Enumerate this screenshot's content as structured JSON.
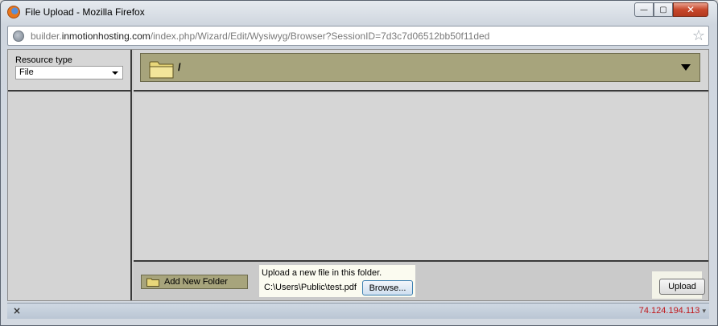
{
  "window": {
    "title": "File Upload - Mozilla Firefox",
    "minimize_glyph": "—",
    "maximize_glyph": "▢",
    "close_glyph": "✕"
  },
  "urlbar": {
    "prefix": "builder.",
    "domain": "inmotionhosting.com",
    "path": "/index.php/Wizard/Edit/Wysiwyg/Browser?SessionID=7d3c7d06512bb50f11ded"
  },
  "sidebar": {
    "resource_type_label": "Resource type",
    "resource_type_value": "File"
  },
  "folder_bar": {
    "path": "/"
  },
  "bottom": {
    "add_folder_label": "Add New Folder",
    "upload_caption": "Upload a new file in this folder.",
    "file_value": "C:\\Users\\Public\\test.pdf",
    "browse_label": "Browse...",
    "upload_label": "Upload"
  },
  "statusbar": {
    "close_glyph": "×",
    "ip": "74.124.194.113"
  },
  "colors": {
    "folder_bar_bg": "#a7a47c",
    "ip_text": "#c0171b"
  },
  "icons": [
    "firefox-icon",
    "globe-icon",
    "star-icon",
    "folder-icon",
    "chevron-down-icon",
    "close-icon"
  ]
}
